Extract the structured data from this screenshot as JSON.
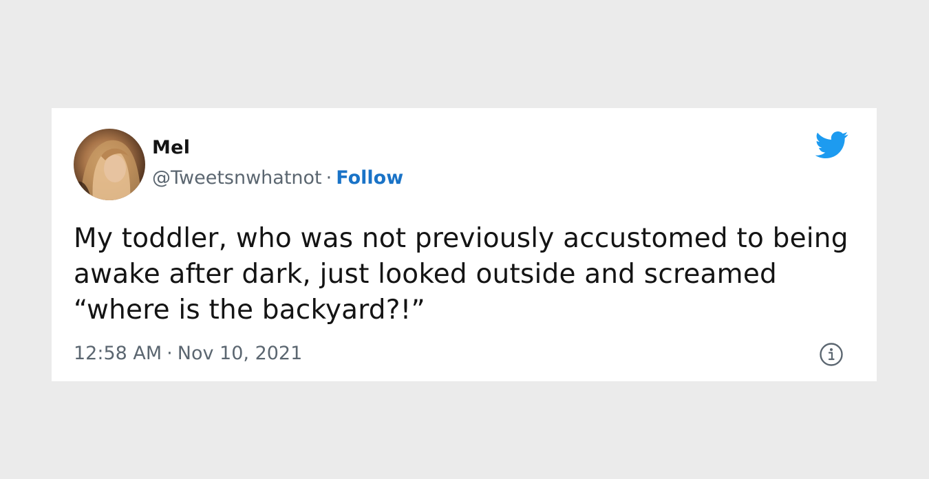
{
  "tweet": {
    "display_name": "Mel",
    "handle": "@Tweetsnwhatnot",
    "separator": "·",
    "follow_label": "Follow",
    "text": "My toddler, who was not previously accustomed to being awake after dark, just looked outside and screamed “where is the backyard?!”",
    "time": "12:58 AM",
    "date": "Nov 10, 2021"
  },
  "icons": {
    "avatar": "avatar",
    "brand": "twitter-bird-icon",
    "info": "info-icon"
  },
  "colors": {
    "background": "#ebebeb",
    "card": "#ffffff",
    "text": "#141414",
    "muted": "#5b6670",
    "link": "#1a73c7",
    "twitter_blue": "#1d9bf0"
  }
}
